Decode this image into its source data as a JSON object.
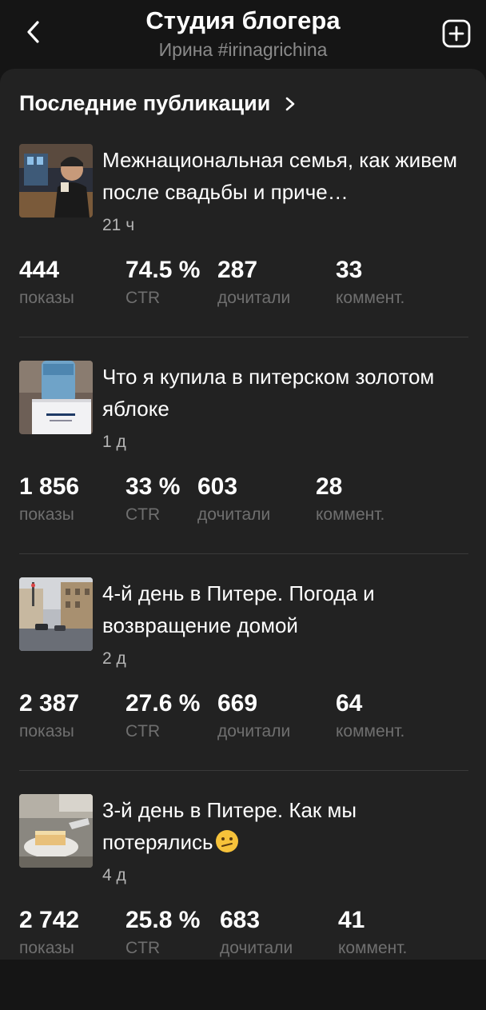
{
  "header": {
    "title": "Студия блогера",
    "subtitle": "Ирина #irinagrichina"
  },
  "section": {
    "title": "Последние публикации"
  },
  "posts": [
    {
      "title": "Межнациональная семья, как живем после свадьбы и приче…",
      "time": "21 ч",
      "stats": [
        {
          "value": "444",
          "label": "показы"
        },
        {
          "value": "74.5 %",
          "label": "CTR"
        },
        {
          "value": "287",
          "label": "дочитали"
        },
        {
          "value": "33",
          "label": "коммент."
        }
      ]
    },
    {
      "title": "Что я купила в питерском золотом яблоке",
      "time": "1 д",
      "stats": [
        {
          "value": "1 856",
          "label": "показы"
        },
        {
          "value": "33 %",
          "label": "CTR"
        },
        {
          "value": "603",
          "label": "дочитали"
        },
        {
          "value": "28",
          "label": "коммент."
        }
      ]
    },
    {
      "title": "4-й день в Питере. Погода и возвращение домой",
      "time": "2 д",
      "stats": [
        {
          "value": "2 387",
          "label": "показы"
        },
        {
          "value": "27.6 %",
          "label": "CTR"
        },
        {
          "value": "669",
          "label": "дочитали"
        },
        {
          "value": "64",
          "label": "коммент."
        }
      ]
    },
    {
      "title": "3-й день в Питере. Как мы потерялись",
      "time": "4 д",
      "stats": [
        {
          "value": "2 742",
          "label": "показы"
        },
        {
          "value": "25.8 %",
          "label": "CTR"
        },
        {
          "value": "683",
          "label": "дочитали"
        },
        {
          "value": "41",
          "label": "коммент."
        }
      ]
    }
  ],
  "icons": {
    "back": "chevron-left-icon",
    "add": "plus-square-icon",
    "section_arrow": "chevron-right-icon",
    "emoji": "confused-face-emoji"
  }
}
